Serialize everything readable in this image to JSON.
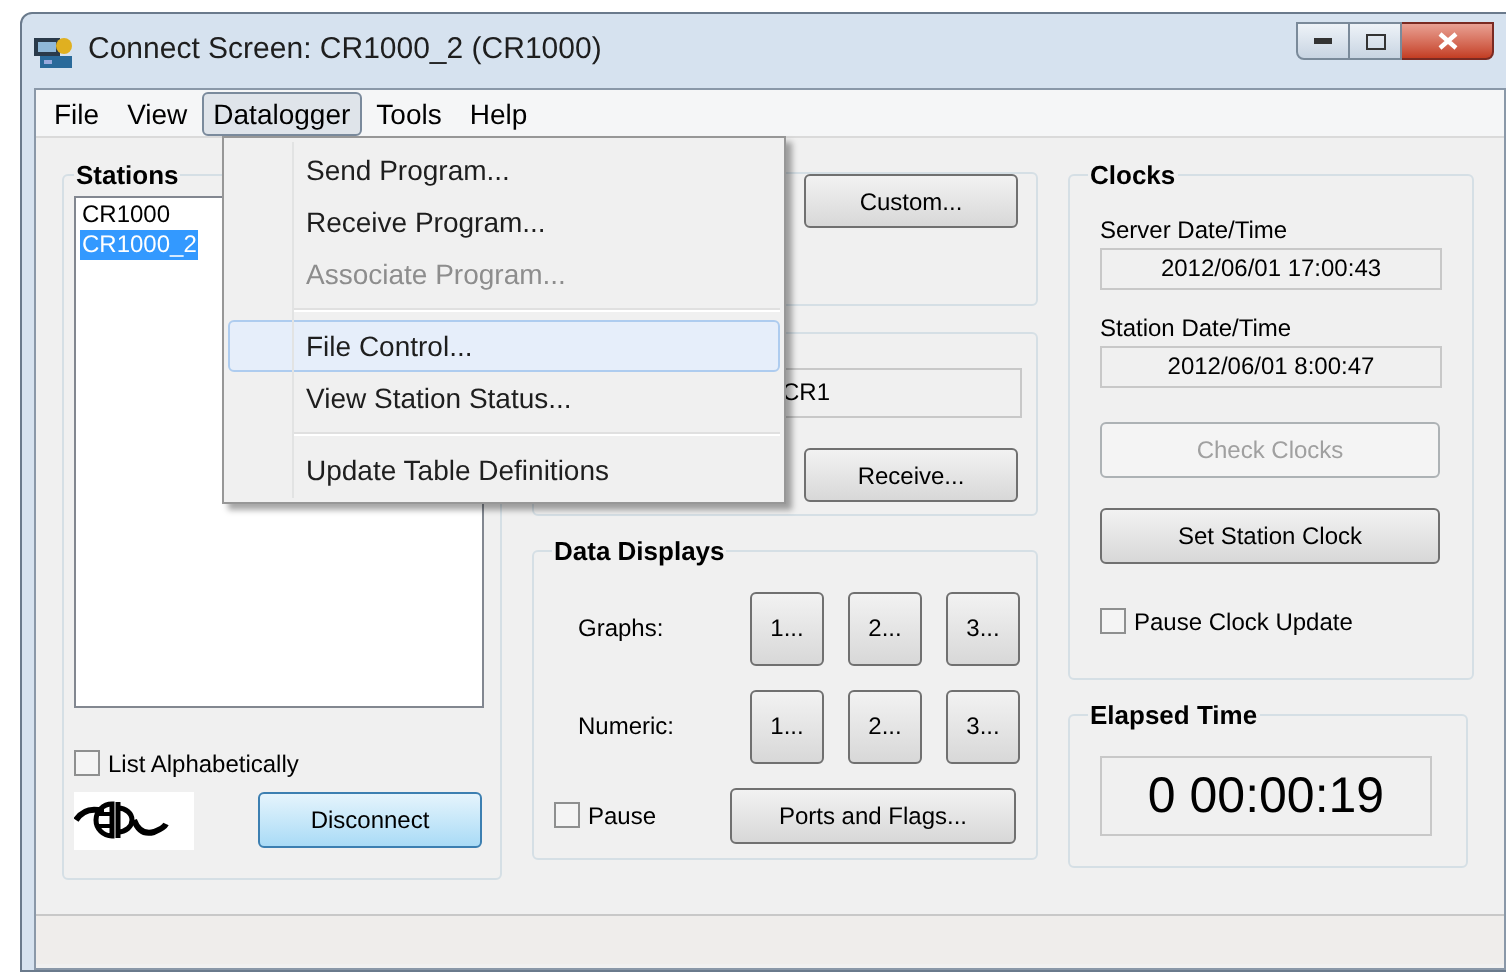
{
  "window": {
    "title": "Connect Screen: CR1000_2 (CR1000)"
  },
  "menu": [
    {
      "label": "File",
      "selected": false
    },
    {
      "label": "View",
      "selected": false
    },
    {
      "label": "Datalogger",
      "selected": true
    },
    {
      "label": "Tools",
      "selected": false
    },
    {
      "label": "Help",
      "selected": false
    }
  ],
  "dropdown": [
    {
      "kind": "item",
      "label": "Send Program...",
      "disabled": false,
      "highlighted": false
    },
    {
      "kind": "item",
      "label": "Receive Program...",
      "disabled": false,
      "highlighted": false
    },
    {
      "kind": "item",
      "label": "Associate Program...",
      "disabled": true,
      "highlighted": false
    },
    {
      "kind": "separator"
    },
    {
      "kind": "item",
      "label": "File Control...",
      "disabled": false,
      "highlighted": true
    },
    {
      "kind": "item",
      "label": "View Station Status...",
      "disabled": false,
      "highlighted": false
    },
    {
      "kind": "separator"
    },
    {
      "kind": "item",
      "label": "Update Table Definitions",
      "disabled": false,
      "highlighted": false
    }
  ],
  "stations": {
    "title": "Stations",
    "items": [
      {
        "label": "CR1000",
        "selected": false
      },
      {
        "label": "CR1000_2",
        "selected": true
      }
    ],
    "list_alphabetically": {
      "label": "List Alphabetically",
      "checked": false
    },
    "disconnect_button": "Disconnect"
  },
  "program": {
    "custom_button": "Custom..."
  },
  "table_files": {
    "field": "CR1",
    "receive_button": "Receive..."
  },
  "data_displays": {
    "title": "Data Displays",
    "rows": [
      {
        "label": "Graphs:",
        "buttons": [
          "1...",
          "2...",
          "3..."
        ]
      },
      {
        "label": "Numeric:",
        "buttons": [
          "1...",
          "2...",
          "3..."
        ]
      }
    ],
    "pause": {
      "label": "Pause",
      "checked": false
    },
    "ports_button": "Ports and Flags..."
  },
  "clocks": {
    "title": "Clocks",
    "server_label": "Server Date/Time",
    "server_value": "2012/06/01 17:00:43",
    "station_label": "Station Date/Time",
    "station_value": "2012/06/01 8:00:47",
    "buttons": [
      {
        "label": "Check Clocks",
        "disabled": true
      },
      {
        "label": "Set Station Clock",
        "disabled": false
      }
    ],
    "pause_update": {
      "label": "Pause Clock Update",
      "checked": false
    }
  },
  "elapsed": {
    "title": "Elapsed Time",
    "value": "0 00:00:19"
  }
}
